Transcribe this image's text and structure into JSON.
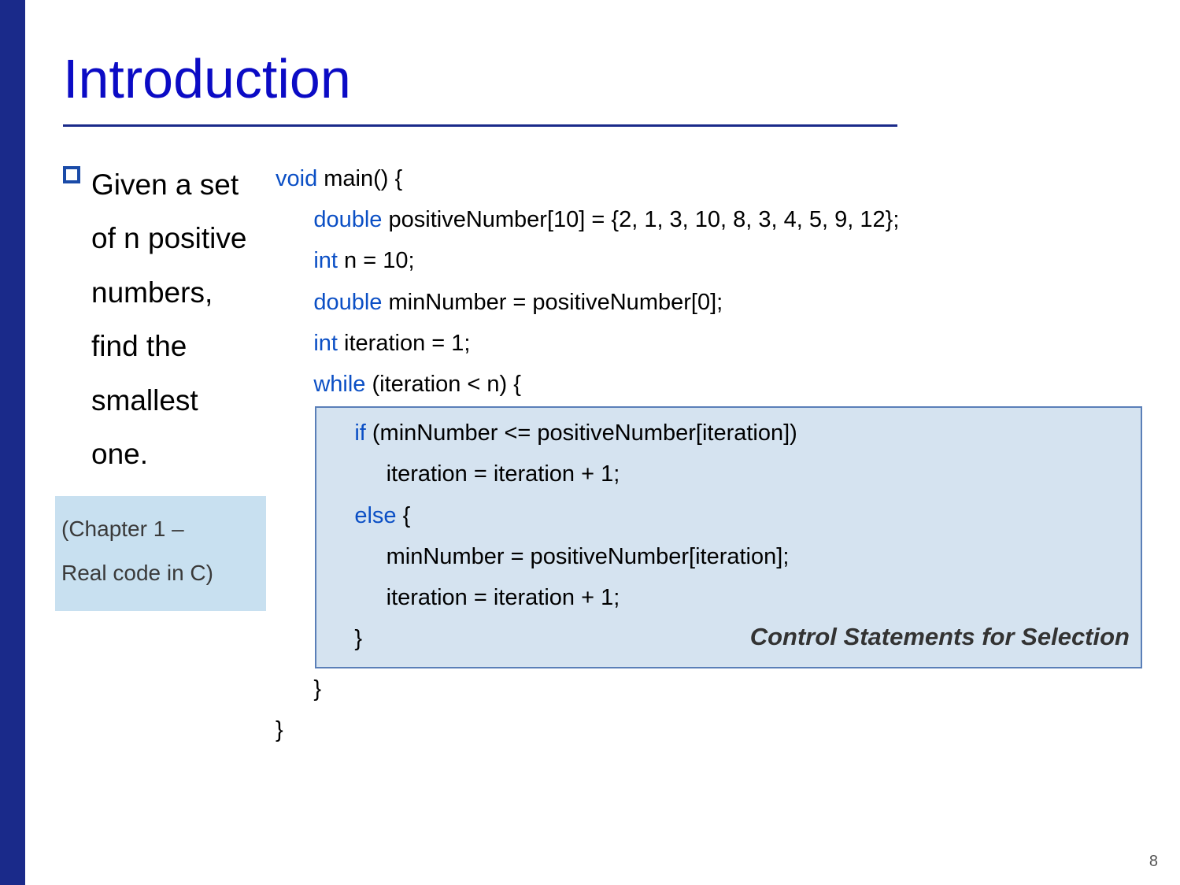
{
  "title": "Introduction",
  "bullet": "Given a set of n positive numbers, find the smallest one.",
  "chapter_line1": "(Chapter 1 –",
  "chapter_line2": "Real code in C)",
  "code": {
    "l1_kw": "void",
    "l1_rest": " main() {",
    "l2_kw": "double",
    "l2_rest": " positiveNumber[10] = {2, 1, 3, 10, 8, 3, 4, 5, 9, 12};",
    "l3_kw": "int",
    "l3_rest": " n = 10;",
    "l4_kw": "double",
    "l4_rest": " minNumber = positiveNumber[0];",
    "l5_kw": "int",
    "l5_rest": " iteration = 1;",
    "l6_kw": "while",
    "l6_rest": " (iteration < n) {",
    "l7_kw": "if",
    "l7_rest": " (minNumber <= positiveNumber[iteration])",
    "l8": "iteration = iteration + 1;",
    "l9_kw": "else",
    "l9_rest": " {",
    "l10": "minNumber = positiveNumber[iteration];",
    "l11": "iteration = iteration + 1;",
    "l12": "}",
    "l13": "}",
    "l14": "}"
  },
  "callout": "Control Statements for Selection",
  "page_number": "8"
}
